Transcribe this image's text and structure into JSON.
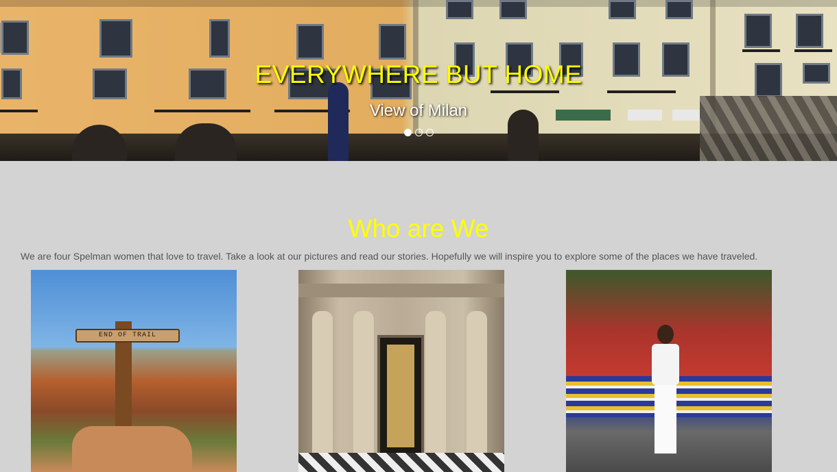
{
  "hero": {
    "title": "EVERYWHERE BUT HOME",
    "caption": "View of Milan",
    "slides": 3,
    "active_slide": 1,
    "title_color": "#ffff00"
  },
  "about": {
    "title": "Who are We",
    "text": "We are four Spelman women that love to travel. Take a look at our pictures and read our stories. Hopefully we will inspire you to explore some of the places we have traveled.",
    "title_color": "#ffff00"
  },
  "photos": {
    "p1": {
      "sign_text": "END OF TRAIL"
    }
  },
  "colors": {
    "background": "#d3d3d3",
    "text": "#555555"
  }
}
